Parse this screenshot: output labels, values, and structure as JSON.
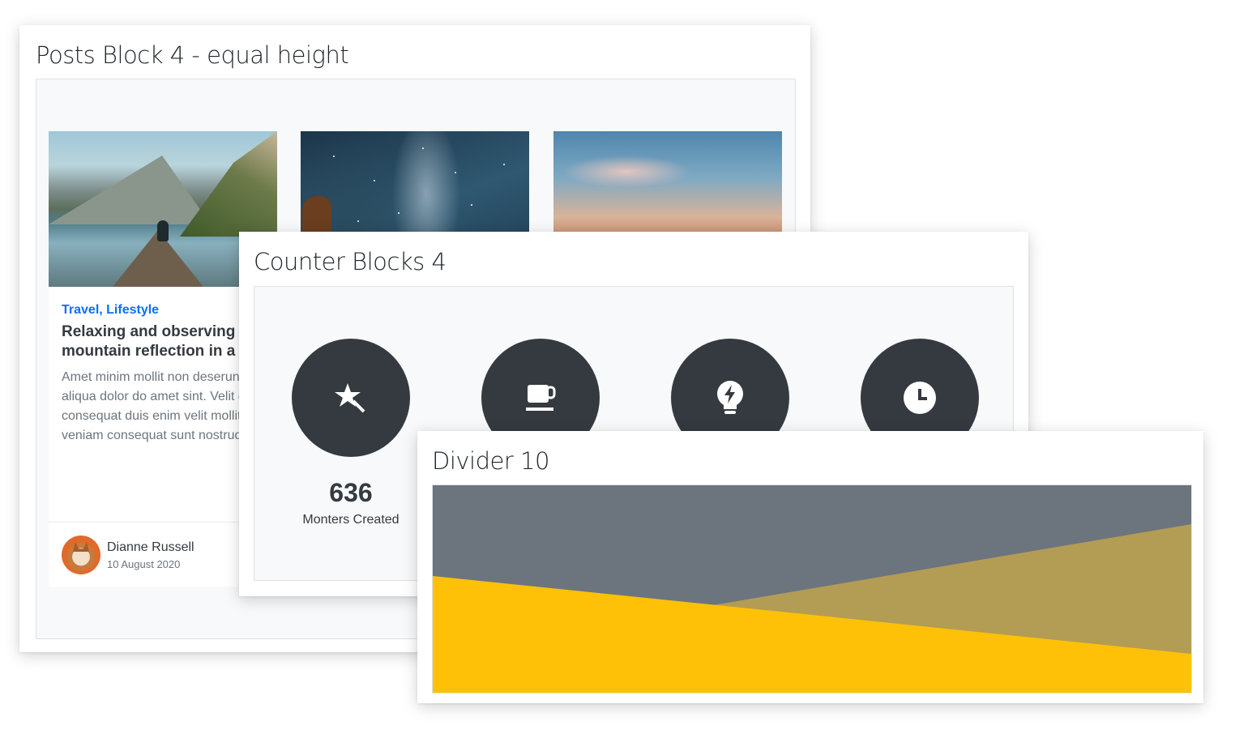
{
  "posts_card": {
    "title": "Posts Block 4 - equal height",
    "post": {
      "categories": "Travel, Lifestyle",
      "title": "Relaxing and observing the mountain reflection in a lake",
      "excerpt": "Amet minim mollit non deserunt ullamco est sit aliqua dolor do amet sint. Velit officia consequat duis enim velit mollit. Exercitation veniam consequat sunt nostrud amet.",
      "author": "Dianne Russell",
      "date": "10 August 2020"
    }
  },
  "counters_card": {
    "title": "Counter Blocks 4",
    "counters": [
      {
        "icon": "magic-wand-icon",
        "value": "636",
        "label": "Monters Created"
      },
      {
        "icon": "coffee-cup-icon"
      },
      {
        "icon": "lightbulb-icon"
      },
      {
        "icon": "clock-icon"
      }
    ]
  },
  "divider_card": {
    "title": "Divider 10",
    "colors": {
      "background": "#6c757d",
      "primary": "#ffc107",
      "secondary": "#b39c54"
    }
  }
}
